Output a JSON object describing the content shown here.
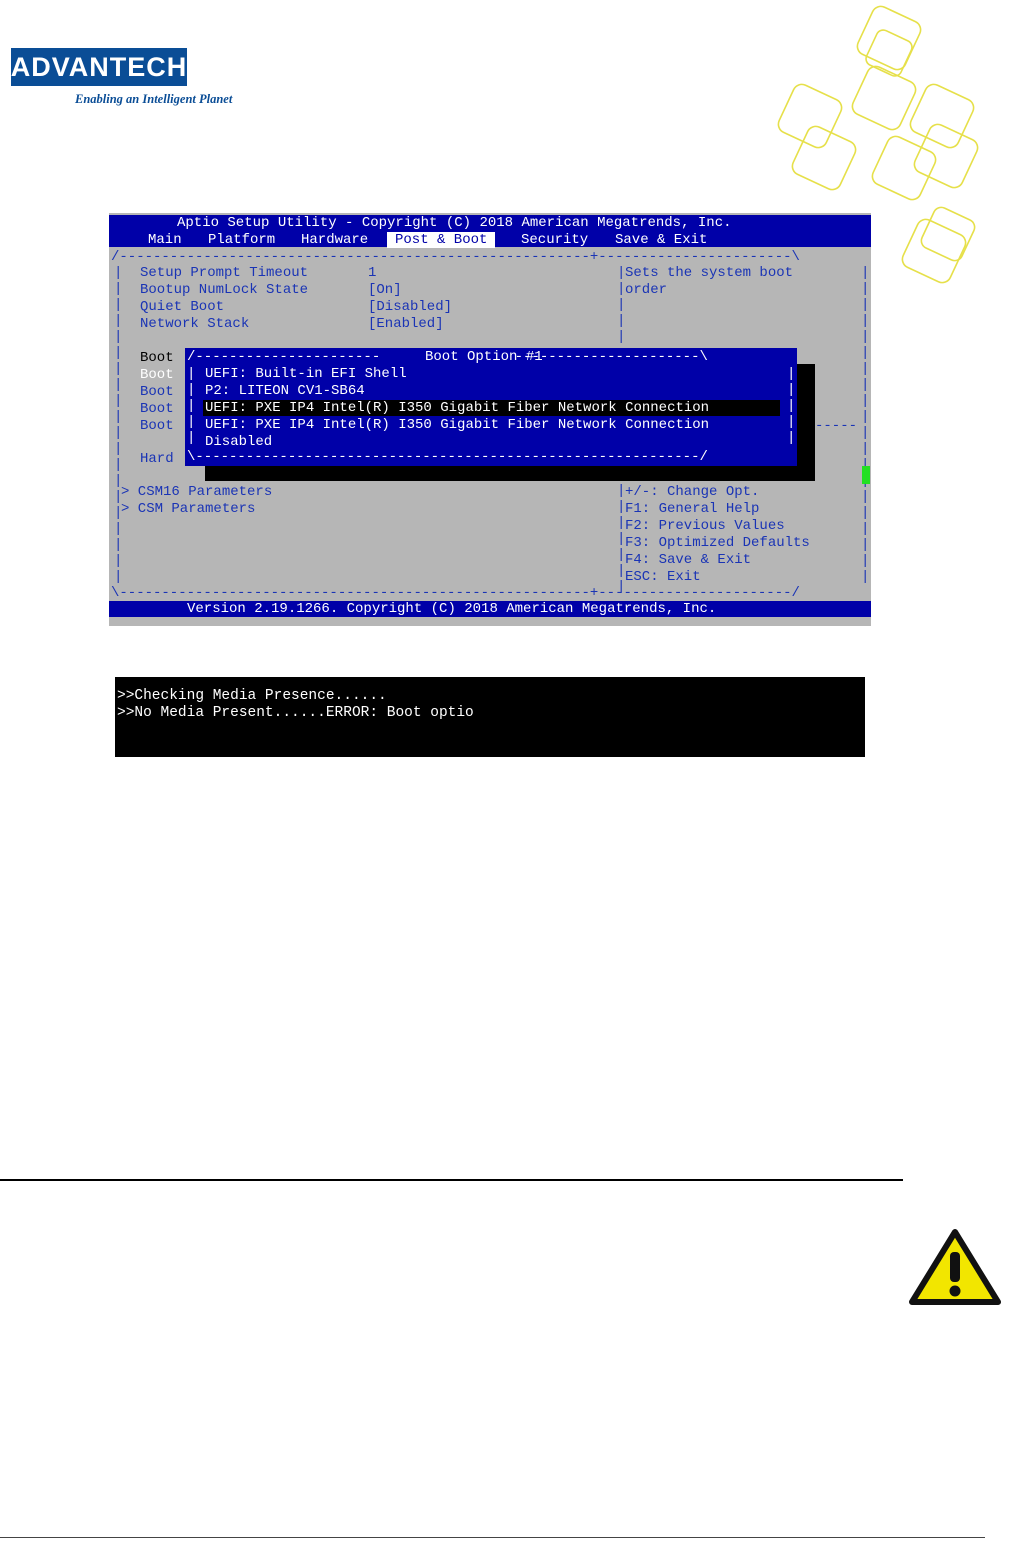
{
  "logo": {
    "brand": "ADVANTECH",
    "tagline": "Enabling an Intelligent Planet"
  },
  "bios": {
    "title": "Aptio Setup Utility - Copyright (C) 2018 American Megatrends, Inc.",
    "tabs": [
      "Main",
      "Platform",
      "Hardware",
      "Post & Boot",
      "Security",
      "Save & Exit"
    ],
    "active_tab": "Post & Boot",
    "settings": [
      {
        "label": "Setup Prompt Timeout",
        "value": "1"
      },
      {
        "label": "Bootup NumLock State",
        "value": "[On]"
      },
      {
        "label": "Quiet Boot",
        "value": "[Disabled]"
      },
      {
        "label": "Network Stack",
        "value": "[Enabled]"
      }
    ],
    "boot_labels": [
      "Boot",
      "Boot",
      "Boot",
      "Boot",
      "Boot",
      "Hard"
    ],
    "submenus": [
      "> CSM16 Parameters",
      "> CSM Parameters"
    ],
    "help_text": [
      "Sets the system boot",
      "order"
    ],
    "keys": [
      "+/-: Change Opt.",
      "F1: General Help",
      "F2: Previous Values",
      "F3: Optimized Defaults",
      "F4: Save & Exit",
      "ESC: Exit"
    ],
    "popup": {
      "title": "Boot Option #1",
      "options": [
        "UEFI: Built-in EFI Shell",
        "P2: LITEON CV1-SB64",
        "UEFI: PXE IP4 Intel(R) I350 Gigabit Fiber Network Connection",
        "UEFI: PXE IP4 Intel(R) I350 Gigabit Fiber Network Connection",
        "Disabled"
      ],
      "selected_index": 2
    },
    "footer": "Version 2.19.1266. Copyright (C) 2018 American Megatrends, Inc."
  },
  "console": {
    "lines": [
      ">>Checking Media Presence......",
      ">>No Media Present......ERROR: Boot optio"
    ]
  },
  "colors": {
    "bios_bg": "#b6b6b6",
    "bios_blue": "#0000a8",
    "bios_text": "#1a34b5",
    "brand_blue": "#0a4d96",
    "deco_yellow": "#e6e04a",
    "warning_yellow": "#f2e600"
  },
  "icons": {
    "warning": "warning-triangle-icon"
  }
}
